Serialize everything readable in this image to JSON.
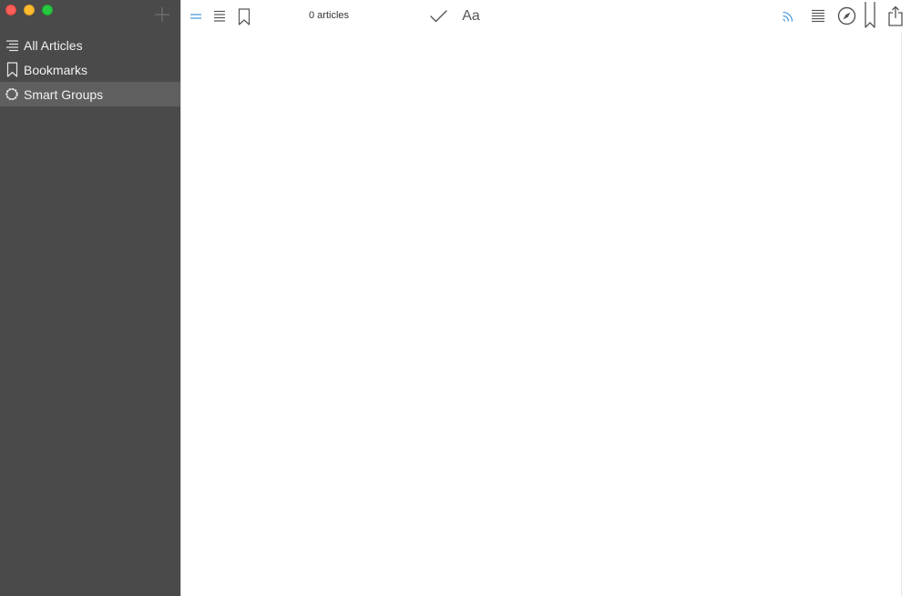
{
  "window": {
    "controls": [
      "close",
      "minimize",
      "zoom"
    ],
    "colors": {
      "close": "#fc5f57",
      "minimize": "#fdbc2e",
      "zoom": "#28c840",
      "sidebar_bg": "#4a4a4a",
      "selected_bg": "#5f5f5f",
      "accent": "#4a9de0"
    }
  },
  "sidebar": {
    "add_icon": "plus-icon",
    "items": [
      {
        "label": "All Articles",
        "icon": "list-icon",
        "selected": false
      },
      {
        "label": "Bookmarks",
        "icon": "bookmark-icon",
        "selected": false
      },
      {
        "label": "Smart Groups",
        "icon": "gear-outline-icon",
        "selected": true
      }
    ]
  },
  "toolbar": {
    "left_icons": [
      "double-line-icon",
      "list-icon",
      "bookmark-icon"
    ],
    "article_count": "0 articles",
    "mark_read_icon": "checkmark-icon",
    "font_label": "Aa",
    "right_icons": [
      "rss-icon",
      "text-lines-icon",
      "compass-icon",
      "bookmark-icon",
      "share-icon"
    ]
  }
}
